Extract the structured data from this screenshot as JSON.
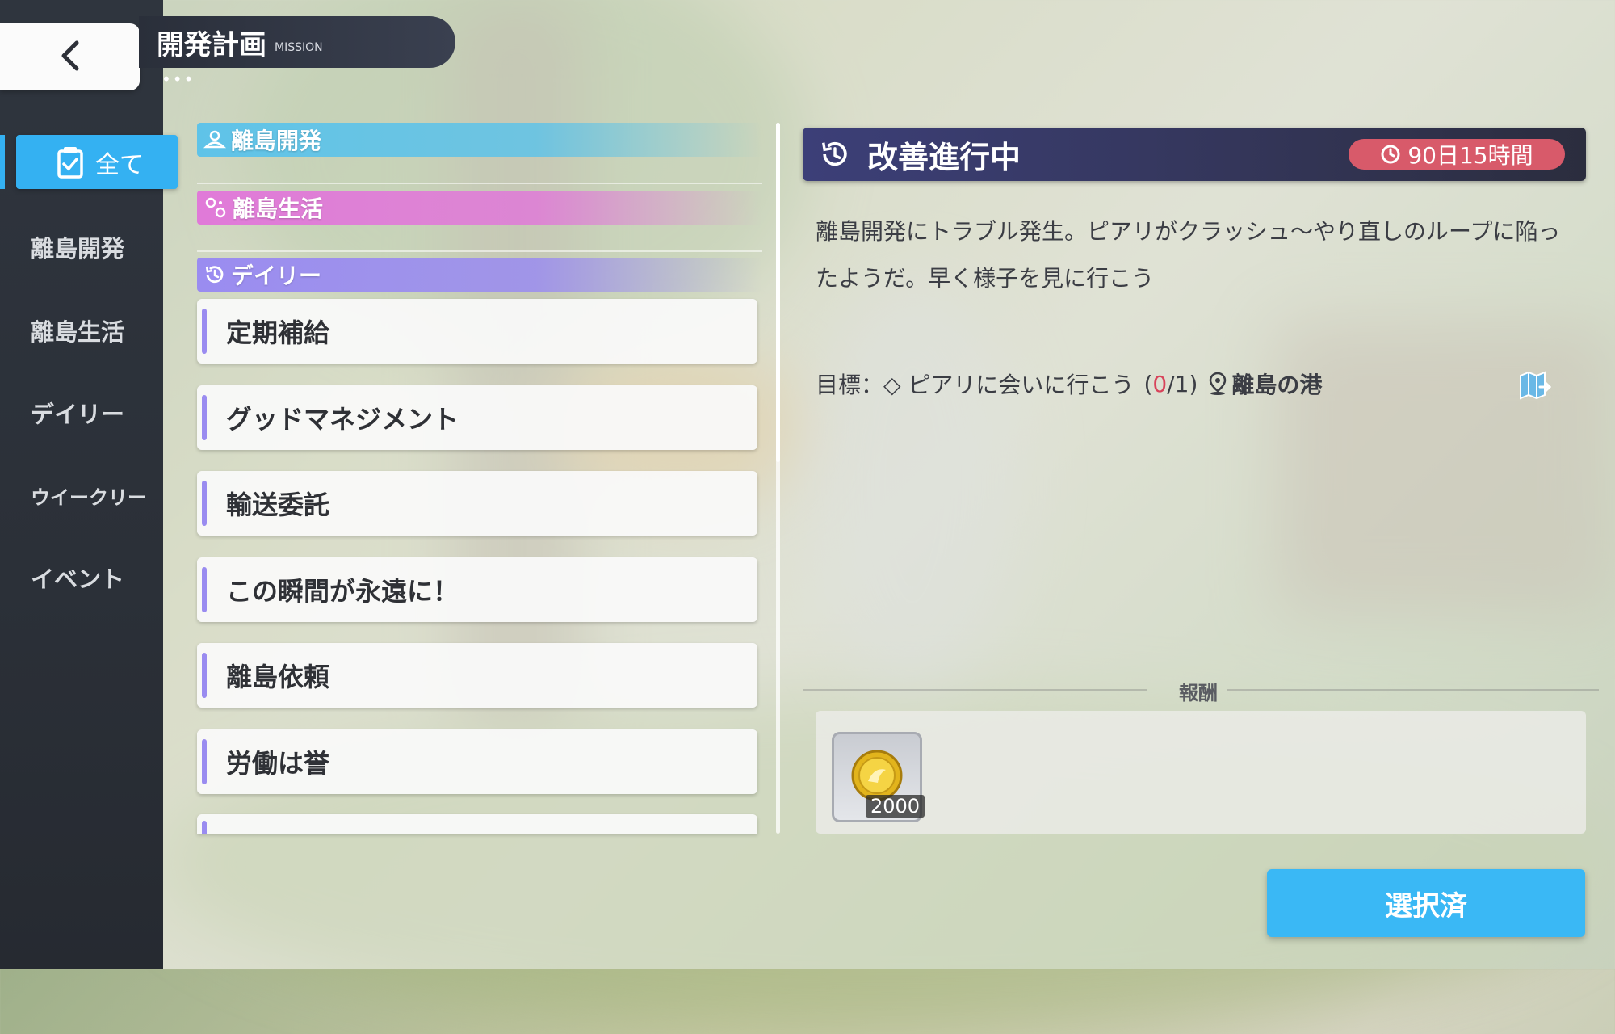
{
  "header": {
    "title": "開発計画",
    "subtitle": "MISSION",
    "dots": "•••"
  },
  "sidebar": {
    "back_icon": "chevron-left-icon",
    "active": {
      "label": "全て",
      "icon": "checklist-icon"
    },
    "items": [
      {
        "label": "離島開発"
      },
      {
        "label": "離島生活"
      },
      {
        "label": "デイリー"
      },
      {
        "label": "ウイークリー"
      },
      {
        "label": "イベント"
      }
    ]
  },
  "categories": [
    {
      "label": "離島開発",
      "icon": "island-icon",
      "color": "#5fc3e8"
    },
    {
      "label": "離島生活",
      "icon": "pin-icon",
      "color": "#e07ad8"
    },
    {
      "label": "デイリー",
      "icon": "history-icon",
      "color": "#9a8cf0"
    }
  ],
  "missions": [
    {
      "label": "定期補給"
    },
    {
      "label": "グッドマネジメント"
    },
    {
      "label": "輸送委託"
    },
    {
      "label": "この瞬間が永遠に！"
    },
    {
      "label": "離島依頼"
    },
    {
      "label": "労働は誉"
    }
  ],
  "detail": {
    "title": "改善進行中",
    "timer": "90日15時間",
    "description": "離島開発にトラブル発生。ピアリがクラッシュ～やり直しのループに陥ったようだ。早く様子を見に行こう",
    "goal": {
      "prefix": "目標：◇ ピアリに会いに行こう",
      "open": "(",
      "current": "0",
      "total": "/1)",
      "location": "離島の港"
    },
    "reward_label": "報酬",
    "reward": {
      "icon": "gold-coin-icon",
      "count": "2000"
    },
    "select_button": "選択済"
  },
  "colors": {
    "accent": "#34b1f2",
    "timer": "#d85a6a",
    "daily": "#9a8cf0"
  }
}
